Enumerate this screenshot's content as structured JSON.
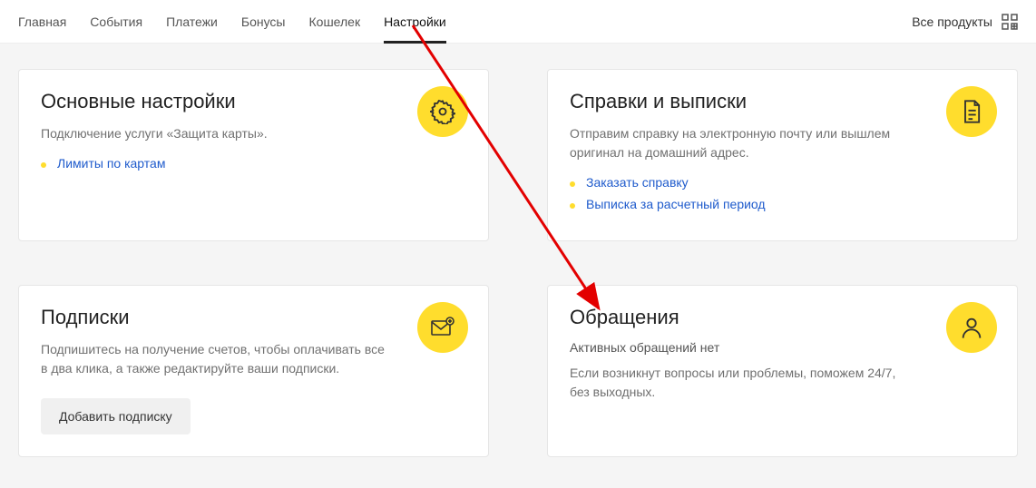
{
  "nav": {
    "tabs": [
      "Главная",
      "События",
      "Платежи",
      "Бонусы",
      "Кошелек",
      "Настройки"
    ],
    "active_index": 5,
    "all_products": "Все продукты"
  },
  "cards": {
    "main_settings": {
      "title": "Основные настройки",
      "desc": "Подключение услуги «Защита карты».",
      "links": [
        "Лимиты по картам"
      ]
    },
    "statements": {
      "title": "Справки и выписки",
      "desc": "Отправим справку на электронную почту или вышлем оригинал на домашний адрес.",
      "links": [
        "Заказать справку",
        "Выписка за расчетный период"
      ]
    },
    "subscriptions": {
      "title": "Подписки",
      "desc": "Подпишитесь на получение счетов, чтобы оплачивать все в два клика, а также редактируйте ваши подписки.",
      "button": "Добавить подписку"
    },
    "requests": {
      "title": "Обращения",
      "sub": "Активных обращений нет",
      "desc": "Если возникнут вопросы или проблемы, поможем 24/7, без выходных."
    }
  }
}
